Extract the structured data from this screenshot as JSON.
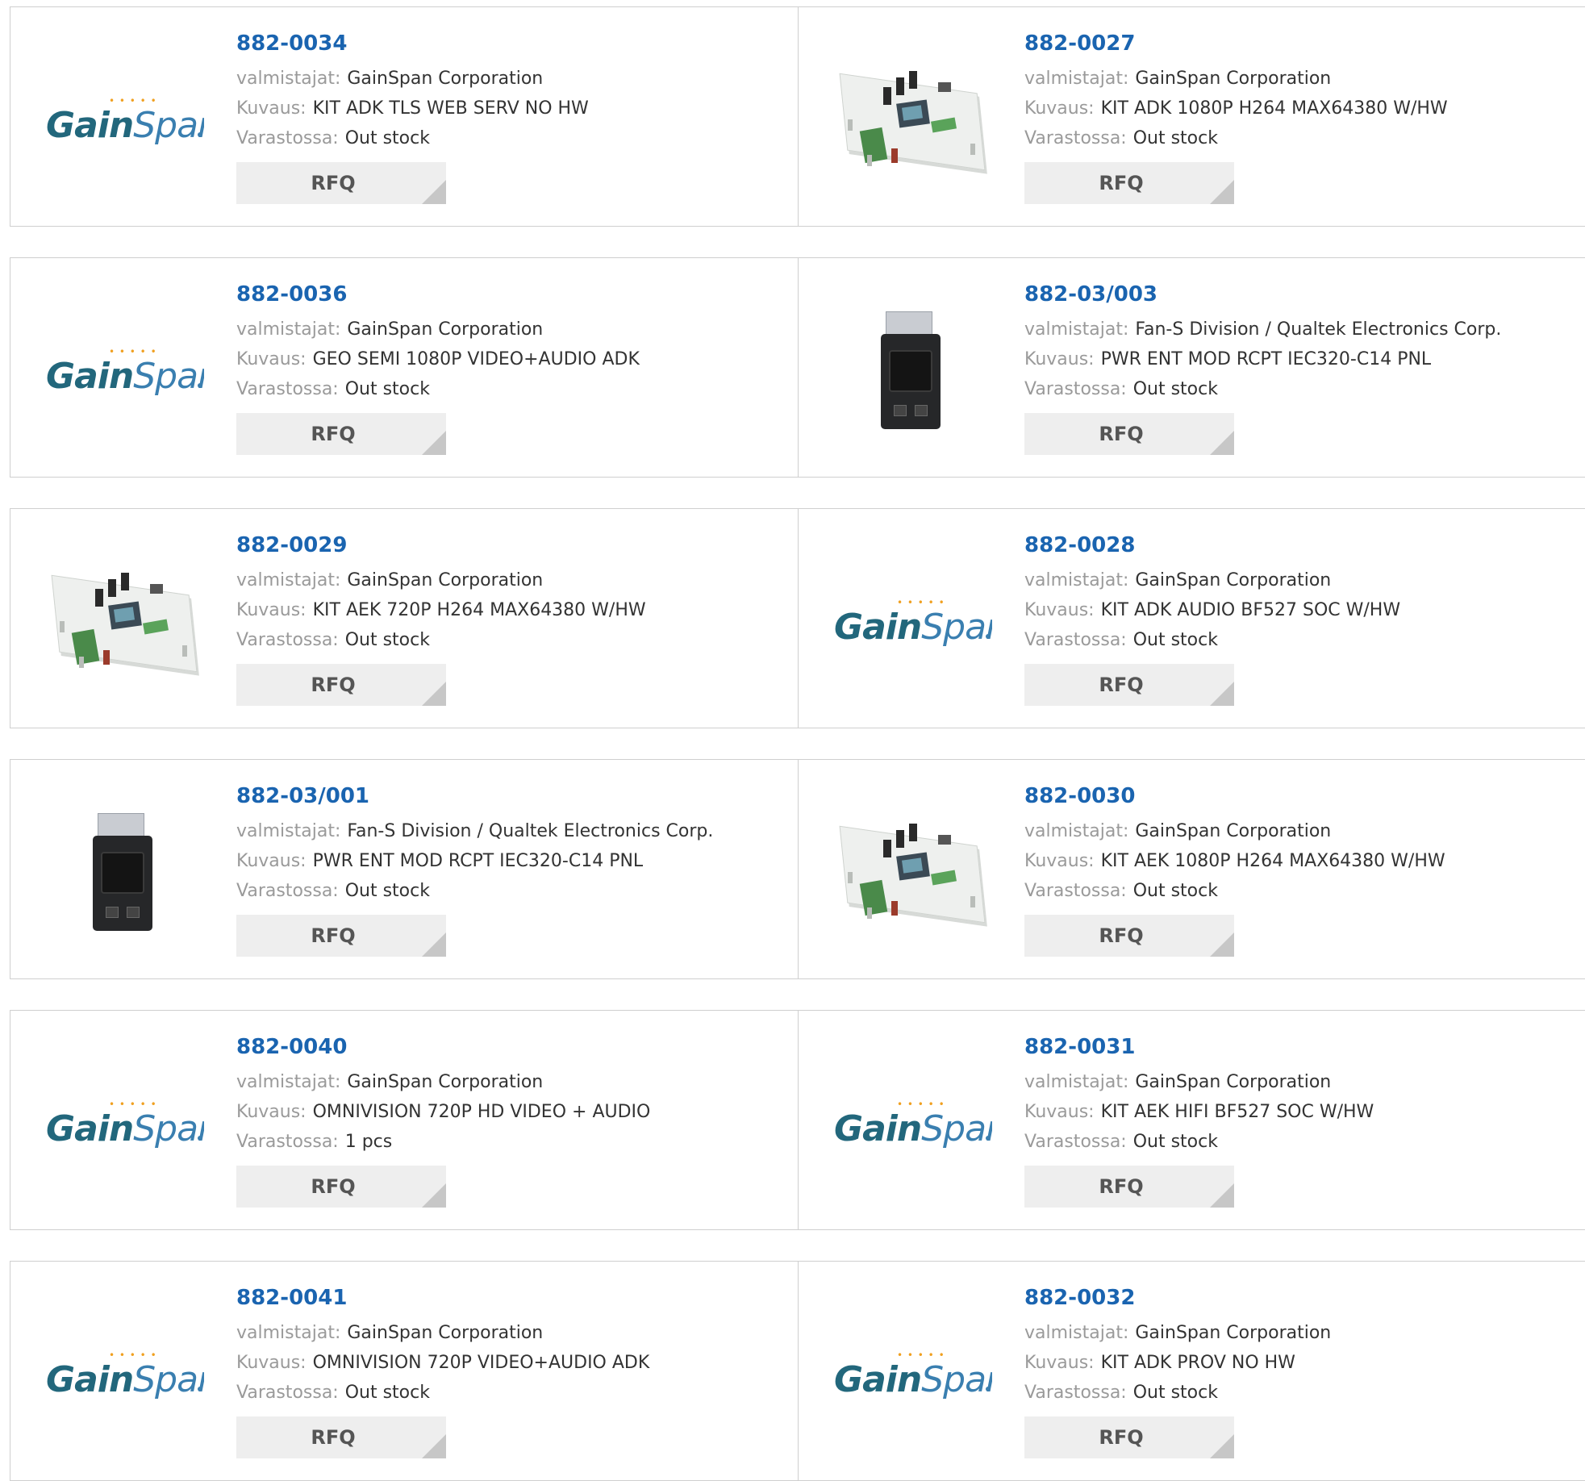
{
  "labels": {
    "manufacturer": "valmistajat:",
    "description": "Kuvaus:",
    "stock": "Varastossa:",
    "rfq": "RFQ"
  },
  "products": [
    {
      "part": "882-0034",
      "manufacturer": "GainSpan Corporation",
      "description": "KIT ADK TLS WEB SERV NO HW",
      "stock": "Out stock",
      "image": "gainspan-logo"
    },
    {
      "part": "882-0027",
      "manufacturer": "GainSpan Corporation",
      "description": "KIT ADK 1080P H264 MAX64380 W/HW",
      "stock": "Out stock",
      "image": "dev-board-photo"
    },
    {
      "part": "882-0036",
      "manufacturer": "GainSpan Corporation",
      "description": "GEO SEMI 1080P VIDEO+AUDIO ADK",
      "stock": "Out stock",
      "image": "gainspan-logo"
    },
    {
      "part": "882-03/003",
      "manufacturer": "Fan-S Division / Qualtek Electronics Corp.",
      "description": "PWR ENT MOD RCPT IEC320-C14 PNL",
      "stock": "Out stock",
      "image": "power-entry-module-photo"
    },
    {
      "part": "882-0029",
      "manufacturer": "GainSpan Corporation",
      "description": "KIT AEK 720P H264 MAX64380 W/HW",
      "stock": "Out stock",
      "image": "dev-board-photo"
    },
    {
      "part": "882-0028",
      "manufacturer": "GainSpan Corporation",
      "description": "KIT ADK AUDIO BF527 SOC W/HW",
      "stock": "Out stock",
      "image": "gainspan-logo"
    },
    {
      "part": "882-03/001",
      "manufacturer": "Fan-S Division / Qualtek Electronics Corp.",
      "description": "PWR ENT MOD RCPT IEC320-C14 PNL",
      "stock": "Out stock",
      "image": "power-entry-module-photo"
    },
    {
      "part": "882-0030",
      "manufacturer": "GainSpan Corporation",
      "description": "KIT AEK 1080P H264 MAX64380 W/HW",
      "stock": "Out stock",
      "image": "dev-board-photo"
    },
    {
      "part": "882-0040",
      "manufacturer": "GainSpan Corporation",
      "description": "OMNIVISION 720P HD VIDEO + AUDIO",
      "stock": "1 pcs",
      "image": "gainspan-logo"
    },
    {
      "part": "882-0031",
      "manufacturer": "GainSpan Corporation",
      "description": "KIT AEK HIFI BF527 SOC W/HW",
      "stock": "Out stock",
      "image": "gainspan-logo"
    },
    {
      "part": "882-0041",
      "manufacturer": "GainSpan Corporation",
      "description": "OMNIVISION 720P VIDEO+AUDIO ADK",
      "stock": "Out stock",
      "image": "gainspan-logo"
    },
    {
      "part": "882-0032",
      "manufacturer": "GainSpan Corporation",
      "description": "KIT ADK PROV NO HW",
      "stock": "Out stock",
      "image": "gainspan-logo"
    }
  ],
  "logo": {
    "text_a": "Gain",
    "text_b": "Span",
    "dots": "• • • • •"
  },
  "colors": {
    "part_link": "#1a64b0",
    "label": "#9a9a9a",
    "value": "#333333",
    "rfq_bg": "#eeeeee",
    "rfq_corner": "#c7c7c7",
    "border": "#cfcfcf"
  }
}
